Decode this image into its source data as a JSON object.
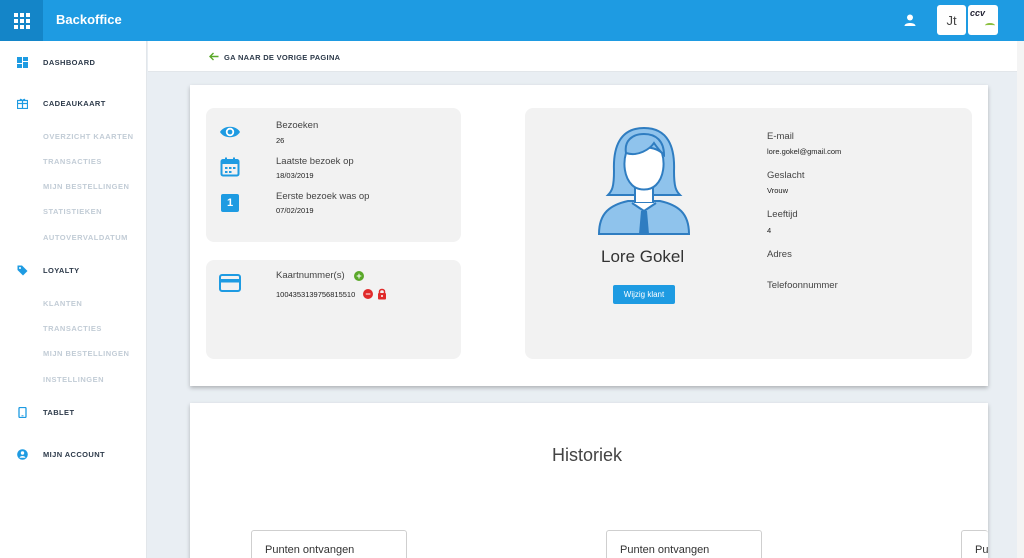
{
  "app": {
    "title": "Backoffice"
  },
  "header": {
    "user_initials": "Jt",
    "brand_logo_text": "ccv"
  },
  "sidebar": {
    "dashboard": "DASHBOARD",
    "cadeaukaart": {
      "label": "CADEAUKAART",
      "items": [
        "OVERZICHT KAARTEN",
        "TRANSACTIES",
        "MIJN BESTELLINGEN",
        "STATISTIEKEN",
        "AUTOVERVALDATUM"
      ]
    },
    "loyalty": {
      "label": "LOYALTY",
      "items": [
        "KLANTEN",
        "TRANSACTIES",
        "MIJN BESTELLINGEN",
        "INSTELLINGEN"
      ]
    },
    "tablet": "TABLET",
    "account": "MIJN ACCOUNT"
  },
  "back": {
    "label": "GA NAAR DE VORIGE PAGINA"
  },
  "stats": {
    "visits_label": "Bezoeken",
    "visits_value": "26",
    "last_visit_label": "Laatste bezoek op",
    "last_visit_value": "18/03/2019",
    "first_visit_label": "Eerste bezoek was op",
    "first_visit_value": "07/02/2019",
    "calendar_day": "1"
  },
  "cards": {
    "label": "Kaartnummer(s)",
    "number": "1004353139756815510"
  },
  "profile": {
    "name": "Lore Gokel",
    "edit_button": "Wijzig klant",
    "email_label": "E-mail",
    "email_value": "lore.gokel@gmail.com",
    "gender_label": "Geslacht",
    "gender_value": "Vrouw",
    "age_label": "Leeftijd",
    "age_value": "4",
    "address_label": "Adres",
    "phone_label": "Telefoonnummer"
  },
  "history": {
    "title": "Historiek",
    "entries": [
      "Punten ontvangen",
      "Punten ontvangen",
      "Pu"
    ]
  },
  "colors": {
    "primary": "#1e9be2",
    "primary_dark": "#1485c8",
    "add": "#5aa829",
    "remove": "#e02a2a"
  }
}
